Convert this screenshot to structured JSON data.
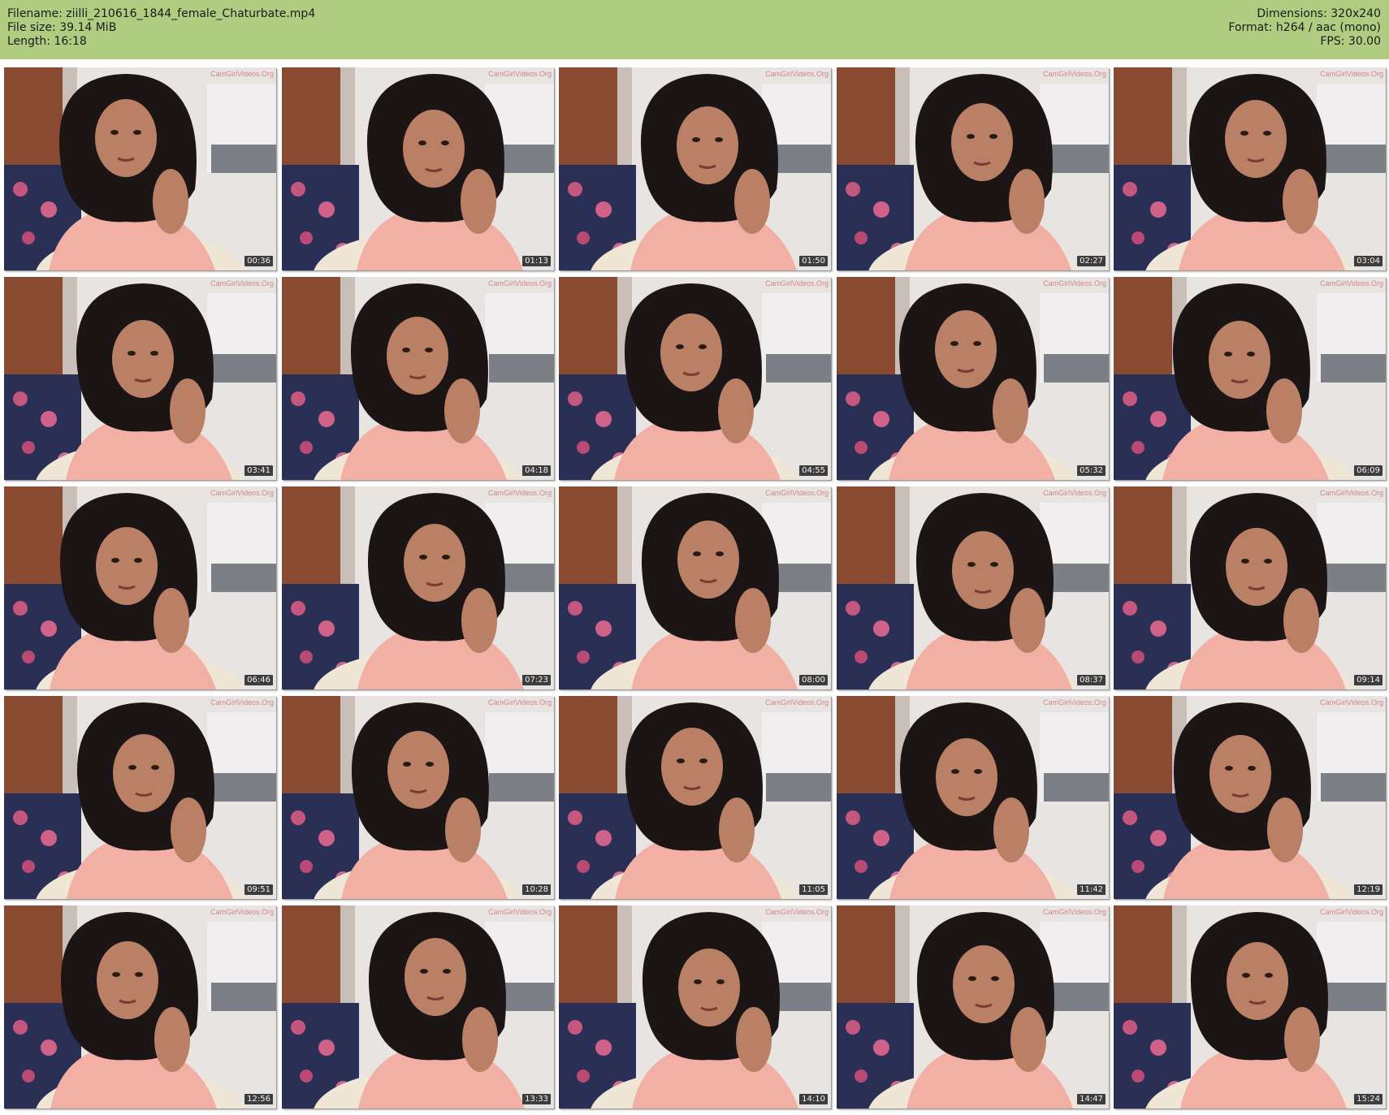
{
  "header": {
    "filename": "Filename: ziilli_210616_1844_female_Chaturbate.mp4",
    "file_size": "File size: 39.14 MiB",
    "length": "Length: 16:18",
    "dimensions": "Dimensions: 320x240",
    "format": "Format: h264 / aac (mono)",
    "fps": "FPS: 30.00"
  },
  "colors": {
    "header_bg": "#b0cc80",
    "watermark": "#d07a86",
    "timestamp_bg": "#191919"
  },
  "watermark_text": "CamGirlVideos.Org",
  "thumbnails": [
    {
      "time": "00:36"
    },
    {
      "time": "01:13"
    },
    {
      "time": "01:50"
    },
    {
      "time": "02:27"
    },
    {
      "time": "03:04"
    },
    {
      "time": "03:41"
    },
    {
      "time": "04:18"
    },
    {
      "time": "04:55"
    },
    {
      "time": "05:32"
    },
    {
      "time": "06:09"
    },
    {
      "time": "06:46"
    },
    {
      "time": "07:23"
    },
    {
      "time": "08:00"
    },
    {
      "time": "08:37"
    },
    {
      "time": "09:14"
    },
    {
      "time": "09:51"
    },
    {
      "time": "10:28"
    },
    {
      "time": "11:05"
    },
    {
      "time": "11:42"
    },
    {
      "time": "12:19"
    },
    {
      "time": "12:56"
    },
    {
      "time": "13:33"
    },
    {
      "time": "14:10"
    },
    {
      "time": "14:47"
    },
    {
      "time": "15:24"
    }
  ]
}
